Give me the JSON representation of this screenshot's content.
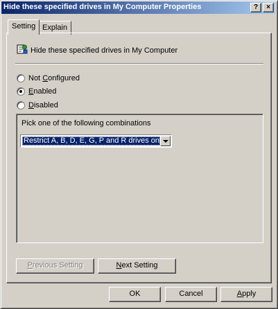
{
  "window": {
    "title": "Hide these specified drives in My Computer Properties",
    "help_button": "?",
    "close_button": "×"
  },
  "tabs": [
    {
      "label": "Setting",
      "active": true
    },
    {
      "label": "Explain",
      "active": false
    }
  ],
  "policy": {
    "icon": "policy-setting-icon",
    "title": "Hide these specified drives in My Computer"
  },
  "options": {
    "not_configured": {
      "label_pre": "Not ",
      "label_mnemonic": "C",
      "label_post": "onfigured",
      "selected": false
    },
    "enabled": {
      "label_pre": "",
      "label_mnemonic": "E",
      "label_post": "nabled",
      "selected": true
    },
    "disabled": {
      "label_pre": "",
      "label_mnemonic": "D",
      "label_post": "isabled",
      "selected": false
    }
  },
  "combinations": {
    "label": "Pick one of the following combinations",
    "selected_value": "Restrict A, B, D, E, G, P and R drives only"
  },
  "nav_buttons": {
    "previous_pre": "",
    "previous_mnemonic": "P",
    "previous_post": "revious Setting",
    "next_pre": "",
    "next_mnemonic": "N",
    "next_post": "ext Setting"
  },
  "dialog_buttons": {
    "ok": "OK",
    "cancel": "Cancel",
    "apply_pre": "",
    "apply_mnemonic": "A",
    "apply_post": "pply"
  },
  "colors": {
    "titlebar_start": "#0a246a",
    "titlebar_end": "#a6caf0",
    "face": "#d4d0c8",
    "selection": "#0a246a"
  }
}
